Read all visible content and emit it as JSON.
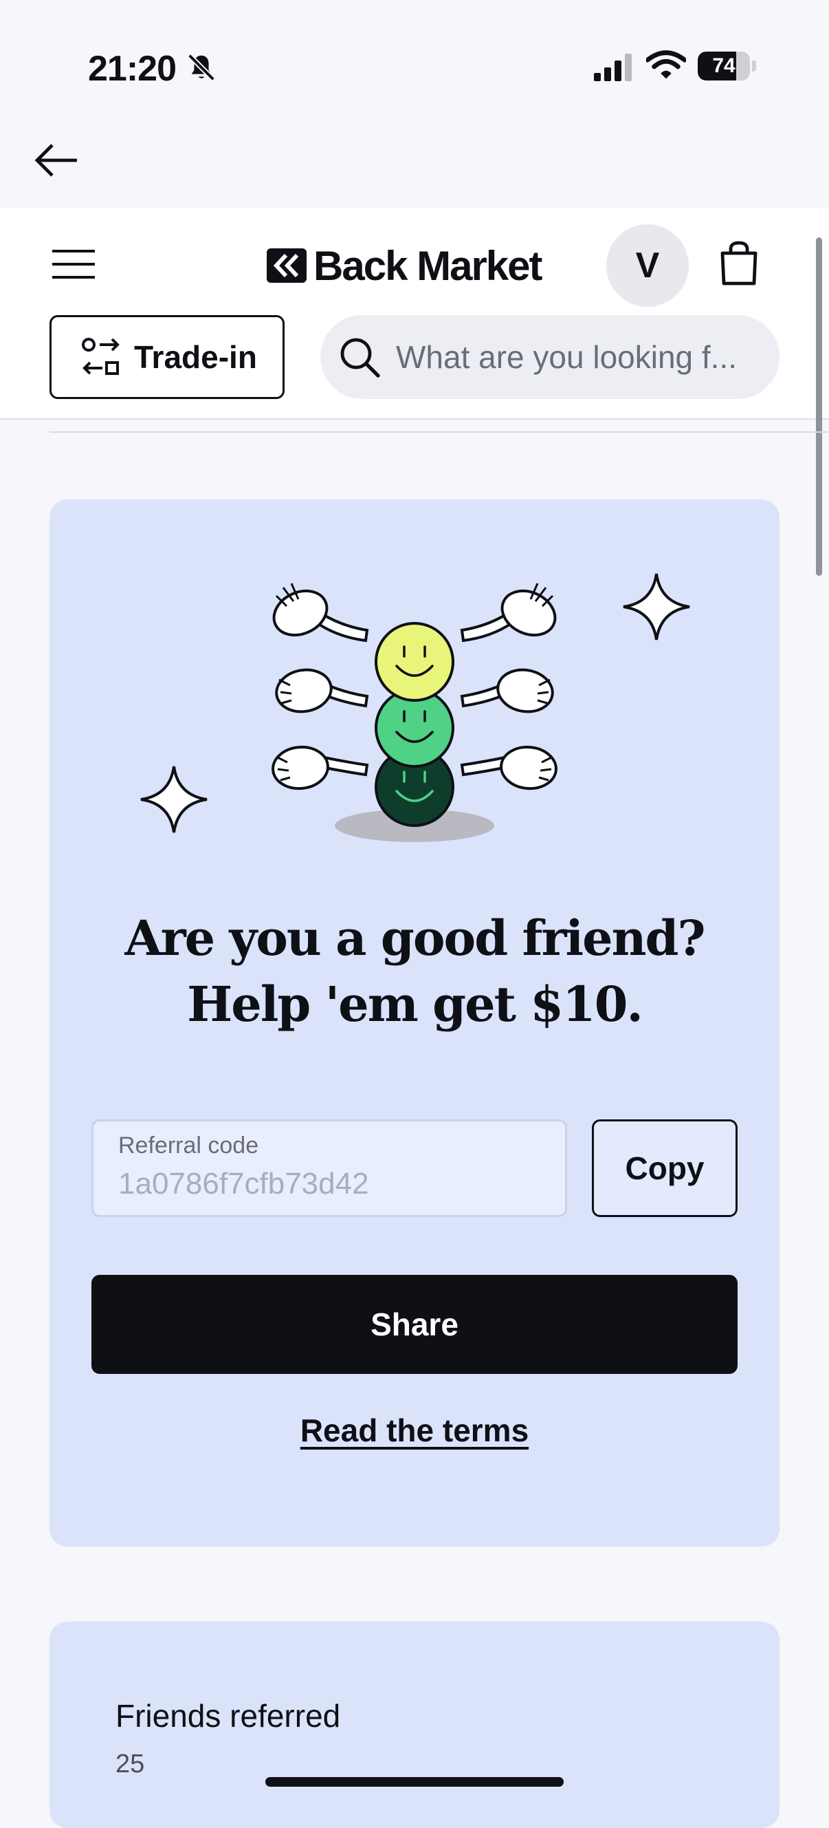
{
  "status_bar": {
    "time": "21:20",
    "battery": "74",
    "battery_level": 0.74
  },
  "header": {
    "brand": "Back Market",
    "avatar_initial": "V",
    "trade_in_label": "Trade-in",
    "search_placeholder": "What are you looking f..."
  },
  "referral": {
    "headline_line1": "Are you a good friend?",
    "headline_line2": "Help 'em get $10.",
    "code_label": "Referral code",
    "code_value": "1a0786f7cfb73d42",
    "copy_label": "Copy",
    "share_label": "Share",
    "terms_label": "Read the terms"
  },
  "stats": {
    "friends_label": "Friends referred",
    "friends_count": "25"
  },
  "colors": {
    "card_bg": "#dbe3fb",
    "primary": "#0e1015",
    "smiley_yellow": "#e9f57a",
    "smiley_green": "#4fd186",
    "smiley_dark": "#0f3d2c"
  },
  "icons": [
    "bell-slash-icon",
    "signal-icon",
    "wifi-icon",
    "battery-icon",
    "back-arrow-icon",
    "menu-icon",
    "shopping-bag-icon",
    "trade-in-icon",
    "search-icon",
    "sparkle-icon"
  ]
}
